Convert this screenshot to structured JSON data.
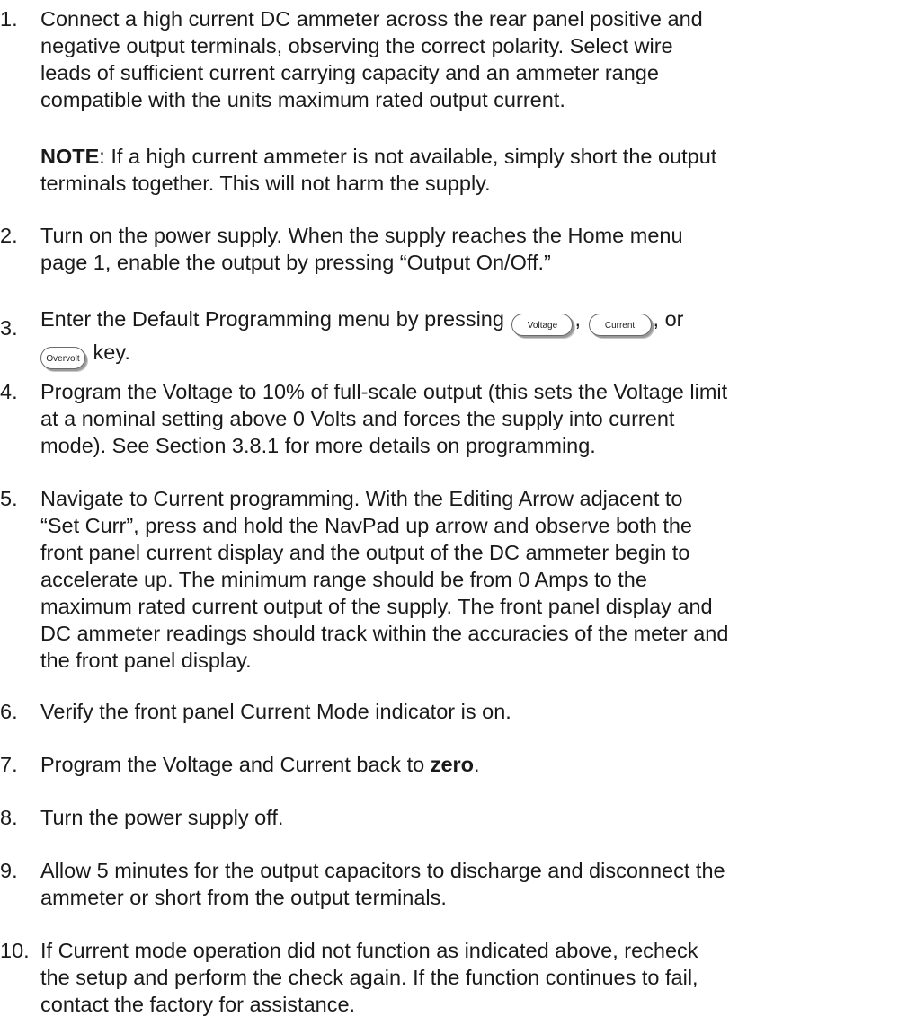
{
  "steps": [
    {
      "number": "1.",
      "lines": [
        "Connect a high current DC ammeter across the rear panel positive and",
        "negative output terminals, observing the correct polarity. Select wire",
        "leads of sufficient current carrying capacity and an ammeter range",
        "compatible with the units maximum rated output current."
      ]
    },
    {
      "number": "2.",
      "lines": [
        "Turn on the power supply.  When the supply reaches the Home menu",
        "page 1, enable the output by pressing “Output On/Off.”"
      ]
    },
    {
      "number": "3.",
      "line1_prefix": "Enter the Default Programming menu by pressing ",
      "sep1": ", ",
      "sep2": ", or",
      "line2_suffix": " key."
    },
    {
      "number": "4.",
      "lines": [
        "Program the Voltage to 10% of full-scale output (this sets the Voltage limit",
        "at a nominal setting above 0 Volts and forces the supply into current",
        "mode).  See Section 3.8.1 for more details on programming."
      ]
    },
    {
      "number": "5.",
      "lines": [
        "Navigate to Current programming.  With the Editing Arrow adjacent to",
        "“Set Curr”, press and hold the NavPad up arrow and observe both the",
        "front panel current display and the output of the DC ammeter begin to",
        "accelerate up.  The minimum range should be from 0 Amps to the",
        "maximum rated current output of the supply.  The front panel display and",
        "DC ammeter readings should track within the accuracies of the meter and",
        "the front panel display."
      ]
    },
    {
      "number": "6.",
      "lines": [
        "Verify the front panel Current Mode indicator is on."
      ]
    },
    {
      "number": "7.",
      "prefix": "Program the Voltage and Current back to ",
      "bold": "zero",
      "suffix": "."
    },
    {
      "number": "8.",
      "lines": [
        "Turn the power supply off."
      ]
    },
    {
      "number": "9.",
      "lines": [
        "Allow 5 minutes for the output capacitors to discharge and disconnect the",
        "ammeter or short from the output terminals."
      ]
    },
    {
      "number": "10.",
      "lines": [
        "If Current mode operation did not function as indicated above, recheck",
        "the setup and perform the check again. If the function continues to fail,",
        "contact the factory for assistance."
      ]
    }
  ],
  "note": {
    "label": "NOTE",
    "line1": ": If a high current ammeter is not available, simply short the output",
    "line2": "terminals together. This will not harm the supply."
  },
  "keys": {
    "voltage": "Voltage",
    "current": "Current",
    "overvolt": "Overvolt"
  }
}
